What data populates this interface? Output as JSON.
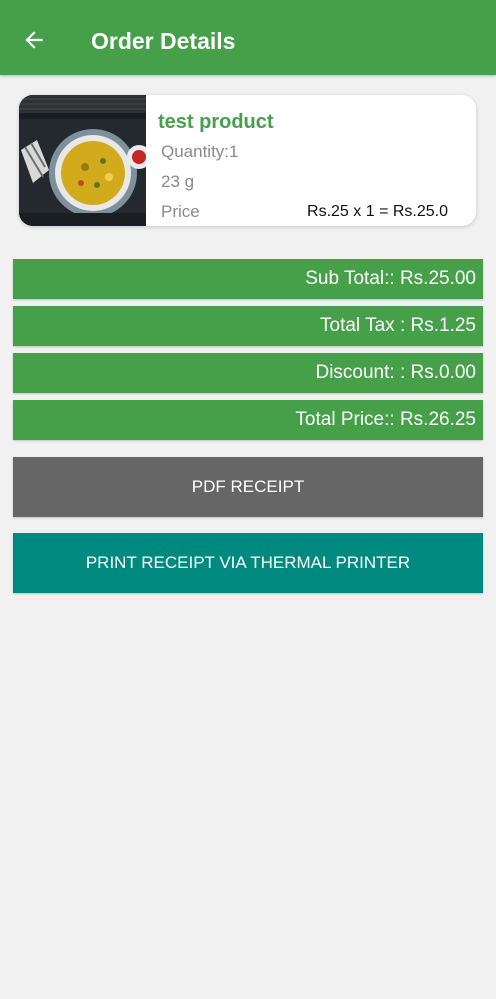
{
  "app_bar": {
    "title": "Order Details",
    "back_icon": "arrow-left-icon",
    "color": "#46a04a"
  },
  "product": {
    "name": "test product",
    "quantity": "Quantity:1",
    "weight": "23 g",
    "price_label": "Price",
    "price_calc": "Rs.25 x 1 = Rs.25.0",
    "image_icon": "food-plate-image"
  },
  "summary": {
    "sub_total": "Sub Total:: Rs.25.00",
    "total_tax": "Total Tax : Rs.1.25",
    "discount": "Discount: : Rs.0.00",
    "total_price": "Total Price:: Rs.26.25",
    "color": "#46a04a"
  },
  "actions": {
    "pdf_receipt": "PDF RECEIPT",
    "pdf_color": "#666666",
    "print_receipt": "PRINT RECEIPT VIA THERMAL PRINTER",
    "print_color": "#00897f"
  }
}
